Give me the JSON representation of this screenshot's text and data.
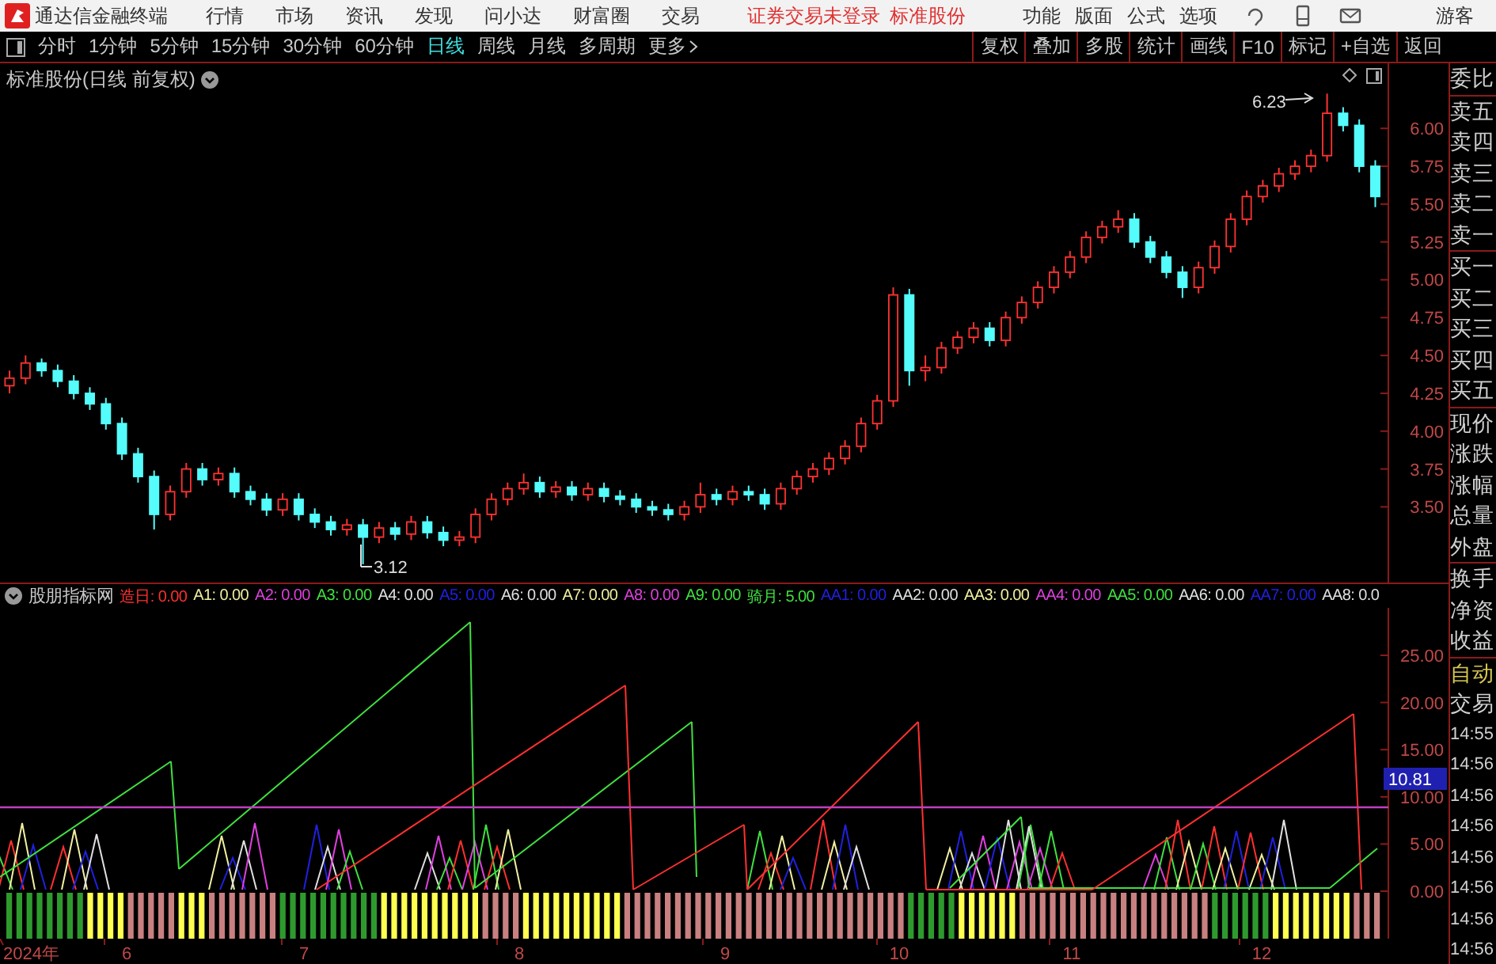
{
  "app_bar": {
    "app_name": "通达信金融终端",
    "menus": [
      "行情",
      "市场",
      "资讯",
      "发现",
      "问小达",
      "财富圈",
      "交易"
    ],
    "notice": "证券交易未登录",
    "stock_link": "标准股份",
    "tools": [
      "功能",
      "版面",
      "公式",
      "选项"
    ],
    "user": "游客"
  },
  "period_bar": {
    "periods": [
      {
        "label": "分时",
        "selected": false
      },
      {
        "label": "1分钟",
        "selected": false
      },
      {
        "label": "5分钟",
        "selected": false
      },
      {
        "label": "15分钟",
        "selected": false
      },
      {
        "label": "30分钟",
        "selected": false
      },
      {
        "label": "60分钟",
        "selected": false
      },
      {
        "label": "日线",
        "selected": true
      },
      {
        "label": "周线",
        "selected": false
      },
      {
        "label": "月线",
        "selected": false
      },
      {
        "label": "多周期",
        "selected": false
      }
    ],
    "more": "更多"
  },
  "toolbar_buttons": [
    "复权",
    "叠加",
    "多股",
    "统计",
    "画线",
    "F10",
    "标记",
    "+自选",
    "返回"
  ],
  "main_chart": {
    "title": "标准股份(日线 前复权)",
    "high_marker": "6.23",
    "low_marker": "3.12",
    "chart_data": {
      "type": "candlestick",
      "ylim": [
        3.0,
        6.43
      ],
      "yticks": [
        {
          "value": 6,
          "label": "6.00"
        },
        {
          "value": 5.75,
          "label": "5.75"
        },
        {
          "value": 5.5,
          "label": "5.50"
        },
        {
          "value": 5.25,
          "label": "5.25"
        },
        {
          "value": 5,
          "label": "5.00"
        },
        {
          "value": 4.75,
          "label": "4.75"
        },
        {
          "value": 4.5,
          "label": "4.50"
        },
        {
          "value": 4.25,
          "label": "4.25"
        },
        {
          "value": 4,
          "label": "4.00"
        },
        {
          "value": 3.75,
          "label": "3.75"
        },
        {
          "value": 3.5,
          "label": "3.50"
        }
      ],
      "ohlc": [
        [
          4.3,
          4.4,
          4.25,
          4.35
        ],
        [
          4.35,
          4.5,
          4.31,
          4.45
        ],
        [
          4.45,
          4.48,
          4.36,
          4.4
        ],
        [
          4.4,
          4.44,
          4.29,
          4.33
        ],
        [
          4.33,
          4.37,
          4.21,
          4.25
        ],
        [
          4.25,
          4.29,
          4.14,
          4.18
        ],
        [
          4.18,
          4.22,
          4.01,
          4.05
        ],
        [
          4.05,
          4.09,
          3.81,
          3.85
        ],
        [
          3.85,
          3.89,
          3.66,
          3.7
        ],
        [
          3.7,
          3.74,
          3.35,
          3.45
        ],
        [
          3.45,
          3.64,
          3.41,
          3.6
        ],
        [
          3.6,
          3.79,
          3.56,
          3.75
        ],
        [
          3.75,
          3.79,
          3.64,
          3.68
        ],
        [
          3.68,
          3.76,
          3.64,
          3.72
        ],
        [
          3.72,
          3.76,
          3.56,
          3.6
        ],
        [
          3.6,
          3.64,
          3.51,
          3.55
        ],
        [
          3.55,
          3.59,
          3.44,
          3.48
        ],
        [
          3.48,
          3.59,
          3.44,
          3.55
        ],
        [
          3.55,
          3.59,
          3.41,
          3.45
        ],
        [
          3.45,
          3.49,
          3.36,
          3.4
        ],
        [
          3.4,
          3.44,
          3.31,
          3.35
        ],
        [
          3.35,
          3.42,
          3.31,
          3.38
        ],
        [
          3.38,
          3.42,
          3.12,
          3.3
        ],
        [
          3.3,
          3.4,
          3.26,
          3.36
        ],
        [
          3.36,
          3.4,
          3.28,
          3.32
        ],
        [
          3.32,
          3.44,
          3.28,
          3.4
        ],
        [
          3.4,
          3.44,
          3.29,
          3.33
        ],
        [
          3.33,
          3.37,
          3.24,
          3.28
        ],
        [
          3.28,
          3.34,
          3.24,
          3.3
        ],
        [
          3.3,
          3.49,
          3.26,
          3.45
        ],
        [
          3.45,
          3.59,
          3.41,
          3.55
        ],
        [
          3.55,
          3.66,
          3.51,
          3.62
        ],
        [
          3.62,
          3.72,
          3.58,
          3.66
        ],
        [
          3.66,
          3.7,
          3.56,
          3.6
        ],
        [
          3.6,
          3.67,
          3.56,
          3.63
        ],
        [
          3.63,
          3.67,
          3.54,
          3.58
        ],
        [
          3.58,
          3.66,
          3.54,
          3.62
        ],
        [
          3.62,
          3.66,
          3.53,
          3.57
        ],
        [
          3.57,
          3.61,
          3.51,
          3.55
        ],
        [
          3.55,
          3.59,
          3.46,
          3.5
        ],
        [
          3.5,
          3.54,
          3.44,
          3.48
        ],
        [
          3.48,
          3.52,
          3.41,
          3.45
        ],
        [
          3.45,
          3.54,
          3.41,
          3.5
        ],
        [
          3.5,
          3.66,
          3.46,
          3.58
        ],
        [
          3.58,
          3.62,
          3.51,
          3.55
        ],
        [
          3.55,
          3.64,
          3.51,
          3.6
        ],
        [
          3.6,
          3.64,
          3.54,
          3.58
        ],
        [
          3.58,
          3.62,
          3.48,
          3.52
        ],
        [
          3.52,
          3.66,
          3.48,
          3.62
        ],
        [
          3.62,
          3.74,
          3.58,
          3.7
        ],
        [
          3.7,
          3.79,
          3.66,
          3.75
        ],
        [
          3.75,
          3.86,
          3.71,
          3.82
        ],
        [
          3.82,
          3.94,
          3.78,
          3.9
        ],
        [
          3.9,
          4.09,
          3.86,
          4.05
        ],
        [
          4.05,
          4.24,
          4.01,
          4.2
        ],
        [
          4.2,
          4.95,
          4.16,
          4.9
        ],
        [
          4.9,
          4.94,
          4.3,
          4.4
        ],
        [
          4.4,
          4.5,
          4.33,
          4.42
        ],
        [
          4.42,
          4.59,
          4.38,
          4.55
        ],
        [
          4.55,
          4.66,
          4.51,
          4.62
        ],
        [
          4.62,
          4.72,
          4.58,
          4.68
        ],
        [
          4.68,
          4.72,
          4.56,
          4.6
        ],
        [
          4.6,
          4.79,
          4.56,
          4.75
        ],
        [
          4.75,
          4.89,
          4.71,
          4.85
        ],
        [
          4.85,
          4.99,
          4.81,
          4.95
        ],
        [
          4.95,
          5.09,
          4.91,
          5.05
        ],
        [
          5.05,
          5.19,
          5.01,
          5.15
        ],
        [
          5.15,
          5.32,
          5.11,
          5.28
        ],
        [
          5.28,
          5.39,
          5.24,
          5.35
        ],
        [
          5.35,
          5.46,
          5.31,
          5.4
        ],
        [
          5.4,
          5.44,
          5.21,
          5.25
        ],
        [
          5.25,
          5.29,
          5.11,
          5.15
        ],
        [
          5.15,
          5.19,
          5.01,
          5.05
        ],
        [
          5.05,
          5.09,
          4.88,
          4.95
        ],
        [
          4.95,
          5.12,
          4.91,
          5.08
        ],
        [
          5.08,
          5.26,
          5.04,
          5.22
        ],
        [
          5.22,
          5.44,
          5.18,
          5.4
        ],
        [
          5.4,
          5.59,
          5.36,
          5.55
        ],
        [
          5.55,
          5.66,
          5.51,
          5.62
        ],
        [
          5.62,
          5.74,
          5.58,
          5.7
        ],
        [
          5.7,
          5.79,
          5.66,
          5.75
        ],
        [
          5.75,
          5.86,
          5.71,
          5.82
        ],
        [
          5.82,
          6.23,
          5.78,
          6.1
        ],
        [
          6.1,
          6.14,
          5.98,
          6.02
        ],
        [
          6.02,
          6.06,
          5.71,
          5.75
        ],
        [
          5.75,
          5.79,
          5.48,
          5.55
        ]
      ]
    }
  },
  "indicator": {
    "name": "股朋指标网",
    "values": [
      {
        "text": "造日: 0.00",
        "color": "#ff3030"
      },
      {
        "text": "A1: 0.00",
        "color": "#f0f0a0"
      },
      {
        "text": "A2: 0.00",
        "color": "#e040e0"
      },
      {
        "text": "A3: 0.00",
        "color": "#40e040"
      },
      {
        "text": "A4: 0.00",
        "color": "#e0e0e0"
      },
      {
        "text": "A5: 0.00",
        "color": "#2020e0"
      },
      {
        "text": "A6: 0.00",
        "color": "#e0e0e0"
      },
      {
        "text": "A7: 0.00",
        "color": "#f0f0a0"
      },
      {
        "text": "A8: 0.00",
        "color": "#e040e0"
      },
      {
        "text": "A9: 0.00",
        "color": "#40e040"
      },
      {
        "text": "骑月: 5.00",
        "color": "#40e040"
      },
      {
        "text": "AA1: 0.00",
        "color": "#2020e0"
      },
      {
        "text": "AA2: 0.00",
        "color": "#e0e0e0"
      },
      {
        "text": "AA3: 0.00",
        "color": "#f0f0a0"
      },
      {
        "text": "AA4: 0.00",
        "color": "#e040e0"
      },
      {
        "text": "AA5: 0.00",
        "color": "#40e040"
      },
      {
        "text": "AA6: 0.00",
        "color": "#e0e0e0"
      },
      {
        "text": "AA7: 0.00",
        "color": "#2020e0"
      },
      {
        "text": "AA8: 0.0",
        "color": "#e0e0e0"
      }
    ],
    "ticks": [
      "25.00",
      "20.00",
      "15.00",
      "10.00",
      "5.00",
      "0.00"
    ],
    "current_value": "10.81"
  },
  "date_axis": [
    "2024年",
    "6",
    "7",
    "8",
    "9",
    "10",
    "11",
    "12"
  ],
  "side_panel": {
    "groups": [
      [
        "委比"
      ],
      [
        "卖五",
        "卖四",
        "卖三",
        "卖二",
        "卖一"
      ],
      [
        "买一",
        "买二",
        "买三",
        "买四",
        "买五"
      ],
      [
        "现价",
        "涨跌",
        "涨幅",
        "总量",
        "外盘"
      ],
      [
        "换手",
        "净资",
        "收益"
      ]
    ],
    "mode": "自动",
    "trade_header": "交易",
    "times": [
      "14:55",
      "14:56",
      "14:56",
      "14:56",
      "14:56",
      "14:56",
      "14:56",
      "14:56"
    ]
  }
}
